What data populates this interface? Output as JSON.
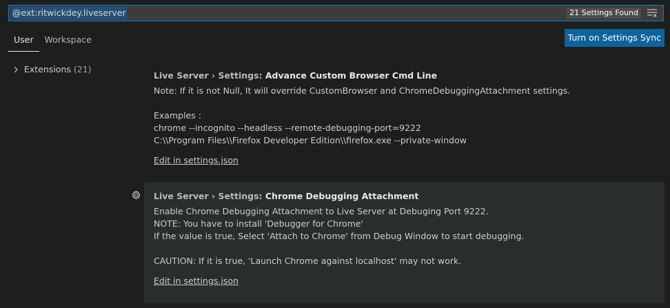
{
  "search": {
    "query": "@ext:ritwickdey.liveserver",
    "found": "21 Settings Found",
    "icon": "clear-filter-icon"
  },
  "tabs": [
    {
      "label": "User",
      "active": true
    },
    {
      "label": "Workspace",
      "active": false
    }
  ],
  "sync_button": "Turn on Settings Sync",
  "tree": {
    "label": "Extensions",
    "count": "(21)"
  },
  "settings": [
    {
      "category": "Live Server › Settings: ",
      "name": "Advance Custom Browser Cmd Line",
      "description": "Note: If it is not Null, It will override CustomBrowser and ChromeDebuggingAttachment settings.\n\nExamples :\nchrome --incognito --headless --remote-debugging-port=9222\nC:\\\\Program Files\\\\Firefox Developer Edition\\\\firefox.exe --private-window",
      "edit_link": "Edit in settings.json"
    },
    {
      "category": "Live Server › Settings: ",
      "name": "Chrome Debugging Attachment",
      "description": "Enable Chrome Debugging Attachment to Live Server at Debuging Port 9222.\nNOTE: You have to install 'Debugger for Chrome'\nIf the value is true, Select 'Attach to Chrome' from Debug Window to start debugging.\n\nCAUTION: If it is true, 'Launch Chrome against localhost' may not work.",
      "edit_link": "Edit in settings.json"
    }
  ],
  "colors": {
    "background": "#1e1e1e",
    "accent": "#0e639c",
    "focus_border": "#007fd4",
    "selection": "#264f78"
  }
}
